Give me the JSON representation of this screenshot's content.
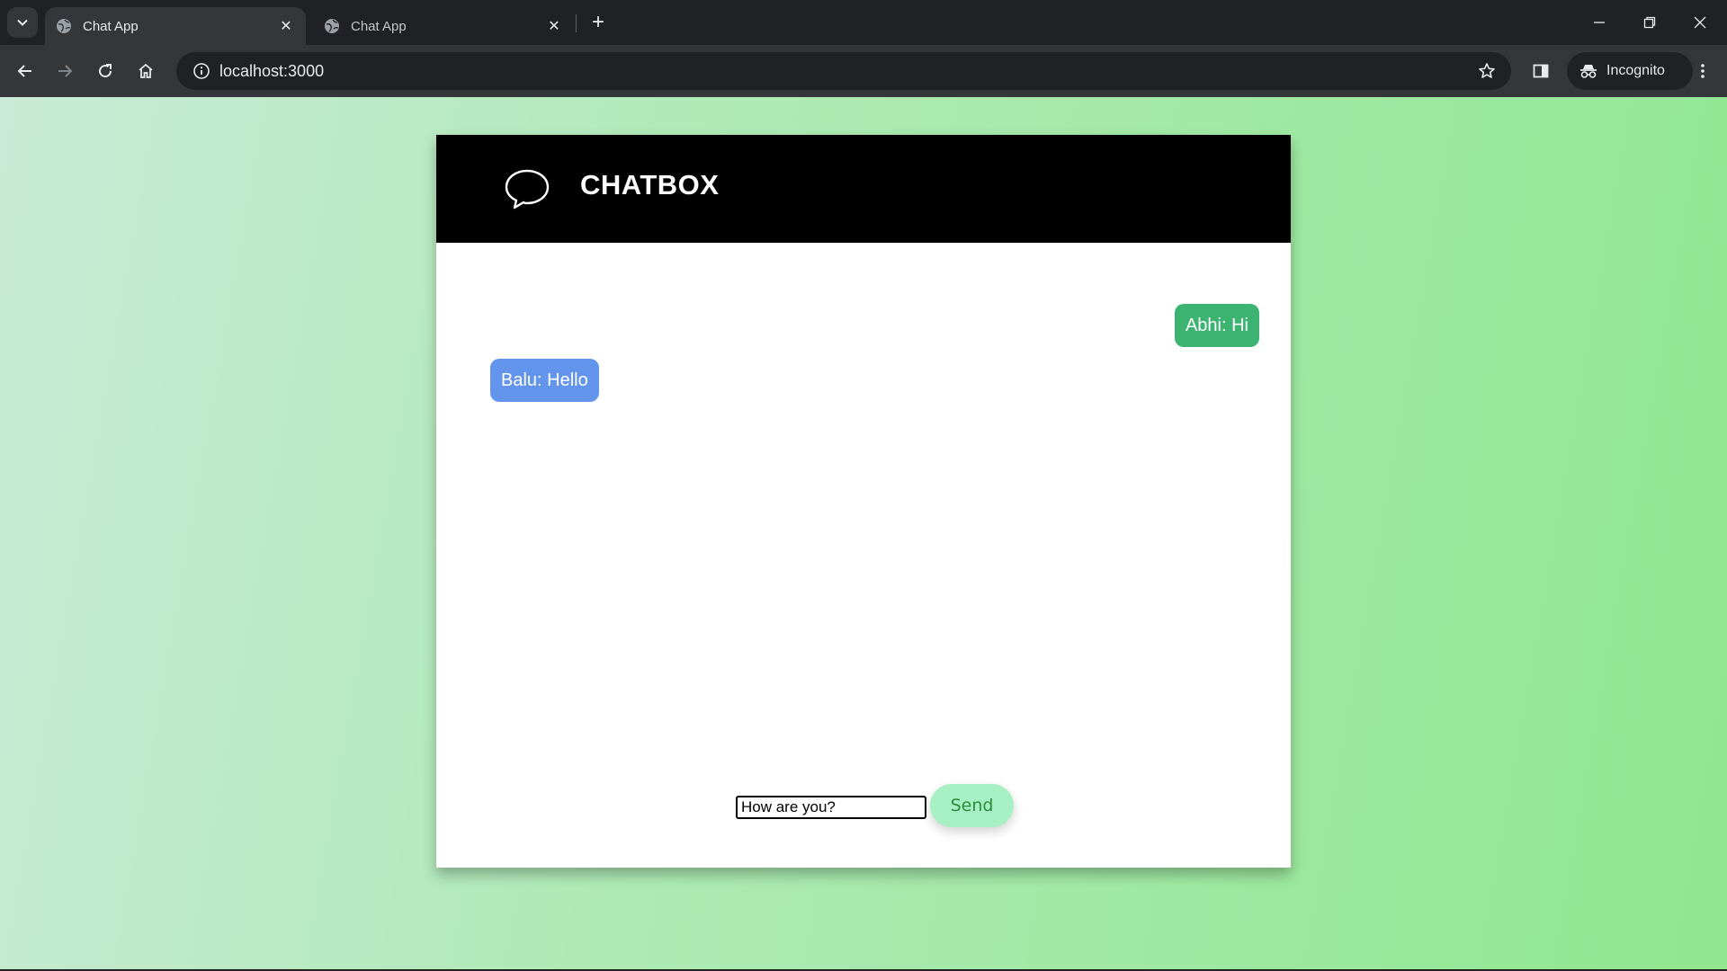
{
  "browser": {
    "tabs": [
      {
        "title": "Chat App",
        "active": true
      },
      {
        "title": "Chat App",
        "active": false
      }
    ],
    "url": "localhost:3000",
    "profile_label": "Incognito"
  },
  "chat": {
    "title": "CHATBOX",
    "messages": [
      {
        "text": "Abhi: Hi",
        "side": "right",
        "color": "#3cb371"
      },
      {
        "text": "Balu: Hello",
        "side": "left",
        "color": "#6495ed"
      }
    ],
    "input_value": "How are you?",
    "send_label": "Send"
  },
  "colors": {
    "header_bg": "#000000",
    "send_button_bg": "#a6f0c4",
    "send_button_text": "#2e8b3d"
  }
}
